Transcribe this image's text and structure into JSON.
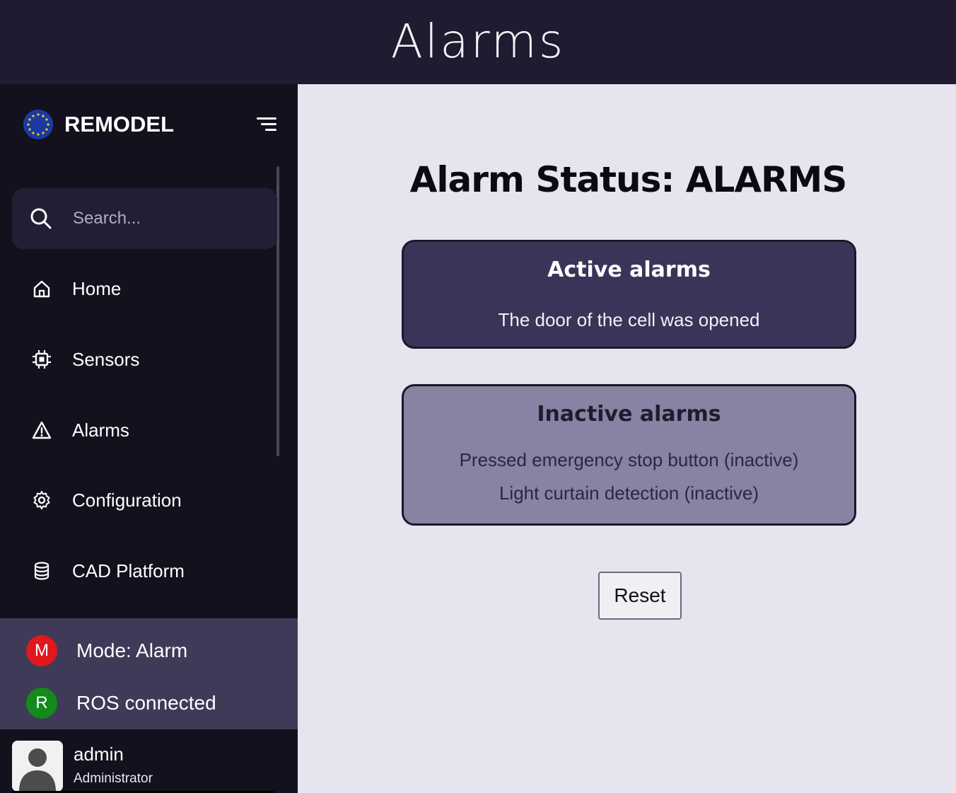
{
  "header": {
    "title": "Alarms"
  },
  "sidebar": {
    "brand": "REMODEL",
    "search": {
      "placeholder": "Search...",
      "value": ""
    },
    "items": [
      {
        "label": "Home",
        "icon": "home-icon"
      },
      {
        "label": "Sensors",
        "icon": "chip-icon"
      },
      {
        "label": "Alarms",
        "icon": "warning-icon"
      },
      {
        "label": "Configuration",
        "icon": "gear-icon"
      },
      {
        "label": "CAD Platform",
        "icon": "database-icon"
      }
    ],
    "status": [
      {
        "badge": "M",
        "text": "Mode: Alarm",
        "color": "#e0181d"
      },
      {
        "badge": "R",
        "text": "ROS connected",
        "color": "#138a1a"
      }
    ],
    "user": {
      "name": "admin",
      "role": "Administrator"
    }
  },
  "main": {
    "status_title": "Alarm Status: ALARMS",
    "active": {
      "title": "Active alarms",
      "items": [
        "The door of the cell was opened"
      ]
    },
    "inactive": {
      "title": "Inactive alarms",
      "items": [
        "Pressed emergency stop button (inactive)",
        "Light curtain detection (inactive)"
      ]
    },
    "reset_label": "Reset"
  }
}
